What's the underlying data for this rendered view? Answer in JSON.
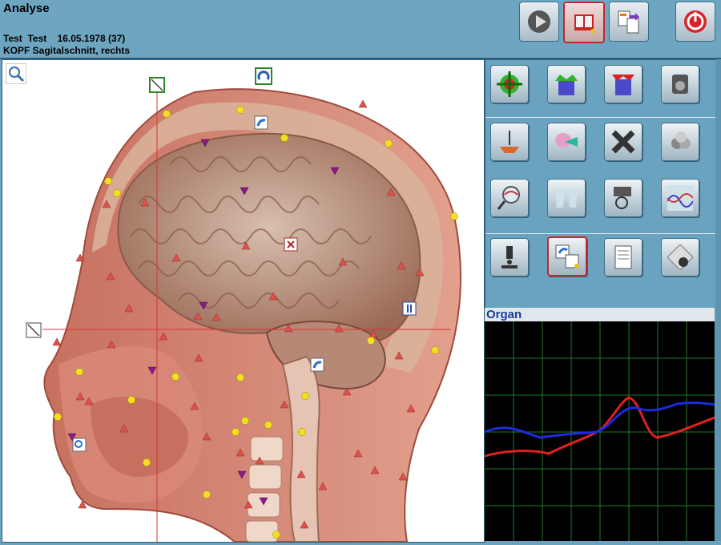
{
  "header": {
    "title": "Analyse",
    "patient": "Test  Test    16.05.1978 (37)",
    "view": "KOPF Sagitalschnitt, rechts"
  },
  "toolbar": [
    {
      "name": "play-icon",
      "active": false
    },
    {
      "name": "book-icon",
      "active": true
    },
    {
      "name": "documents-icon",
      "active": false
    },
    {
      "name": "power-icon",
      "active": false
    }
  ],
  "organ_panel": {
    "label": "Organ",
    "graph": {
      "grid_color": "#1f7a2a",
      "series": [
        {
          "color": "#e02020"
        },
        {
          "color": "#1c2be0"
        }
      ]
    }
  },
  "tools": [
    {
      "name": "target-icon"
    },
    {
      "name": "funnel-up-icon"
    },
    {
      "name": "funnel-down-icon"
    },
    {
      "name": "device-icon"
    },
    {
      "name": "scale-icon"
    },
    {
      "name": "organ-arrow-icon"
    },
    {
      "name": "x-icon"
    },
    {
      "name": "spheres-icon"
    },
    {
      "name": "magnify-dna-icon"
    },
    {
      "name": "cups-icon"
    },
    {
      "name": "scan-pointer-icon"
    },
    {
      "name": "wave-chart-icon"
    },
    {
      "name": "microscope-icon"
    },
    {
      "name": "rotate-view-icon"
    },
    {
      "name": "notes-icon"
    },
    {
      "name": "diamond-heart-icon"
    }
  ],
  "colors": {
    "accent": "#6aa3bf",
    "marker_triangle": "#e0504a",
    "marker_hexagon": "#f2e020",
    "marker_inverted": "#8a1a8a",
    "crosshair": "#e03030"
  }
}
